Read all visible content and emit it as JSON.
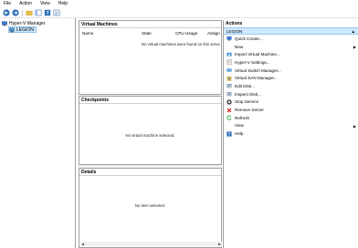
{
  "menu": [
    "File",
    "Action",
    "View",
    "Help"
  ],
  "toolbar": {
    "icons": [
      "back-arrow-icon",
      "forward-arrow-icon",
      "up-folder-icon",
      "show-hide-tree-icon",
      "help-icon",
      "properties-icon"
    ]
  },
  "tree": {
    "root": "Hyper-V Manager",
    "child": "LEGION"
  },
  "virtual_machines": {
    "title": "Virtual Machines",
    "columns": [
      "Name",
      "State",
      "CPU Usage",
      "Assign"
    ],
    "empty_message": "No virtual machines were found on this serve"
  },
  "checkpoints": {
    "title": "Checkpoints",
    "message": "No virtual machine selected."
  },
  "details": {
    "title": "Details",
    "message": "No item selected."
  },
  "actions": {
    "title": "Actions",
    "section": "LEGION",
    "items": [
      {
        "label": "Quick Create...",
        "icon": "quick-create-icon",
        "submenu": false
      },
      {
        "label": "New",
        "icon": "",
        "submenu": true
      },
      {
        "label": "Import Virtual Machine...",
        "icon": "import-icon",
        "submenu": false
      },
      {
        "label": "Hyper-V Settings...",
        "icon": "settings-icon",
        "submenu": false
      },
      {
        "label": "Virtual Switch Manager...",
        "icon": "switch-icon",
        "submenu": false
      },
      {
        "label": "Virtual SAN Manager...",
        "icon": "san-icon",
        "submenu": false
      },
      {
        "label": "Edit Disk...",
        "icon": "edit-disk-icon",
        "submenu": false
      },
      {
        "label": "Inspect Disk...",
        "icon": "inspect-disk-icon",
        "submenu": false
      },
      {
        "label": "Stop Service",
        "icon": "stop-icon",
        "submenu": false
      },
      {
        "label": "Remove Server",
        "icon": "remove-icon",
        "submenu": false
      },
      {
        "label": "Refresh",
        "icon": "refresh-icon",
        "submenu": false
      },
      {
        "label": "View",
        "icon": "",
        "submenu": true
      },
      {
        "label": "Help",
        "icon": "help-icon",
        "submenu": false
      }
    ]
  }
}
